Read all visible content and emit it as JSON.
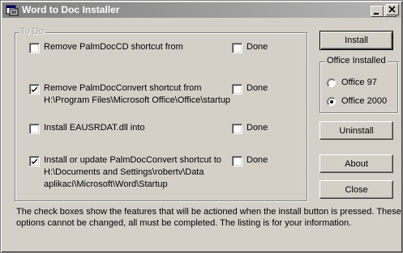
{
  "window": {
    "title": "Word to Doc Installer"
  },
  "todo": {
    "legend": "To Do",
    "done_label": "Done",
    "items": [
      {
        "label": "Remove PalmDocCD shortcut from",
        "checked": false,
        "done": false
      },
      {
        "label": "Remove PalmDocConvert shortcut from\nH:\\Program Files\\Microsoft Office\\Office\\startup",
        "checked": true,
        "done": false
      },
      {
        "label": "Install EAUSRDAT.dll into",
        "checked": false,
        "done": false
      },
      {
        "label": "Install or update PalmDocConvert shortcut to\nH:\\Documents and Settings\\robertv\\Data\naplikací\\Microsoft\\Word\\Startup",
        "checked": true,
        "done": false
      }
    ]
  },
  "buttons": {
    "install": "Install",
    "uninstall": "Uninstall",
    "about": "About",
    "close": "Close"
  },
  "office_installed": {
    "legend": "Office Installed",
    "options": [
      {
        "label": "Office 97",
        "selected": false
      },
      {
        "label": "Office 2000",
        "selected": true
      }
    ]
  },
  "info_text": "The check boxes show the features that will be actioned when the install button is pressed. These\noptions cannot be changed, all must be completed. The listing is for your information.",
  "icons": [
    "app-icon",
    "minimize-icon",
    "maximize-icon",
    "close-icon",
    "checkmark-icon",
    "radio-dot-icon"
  ]
}
